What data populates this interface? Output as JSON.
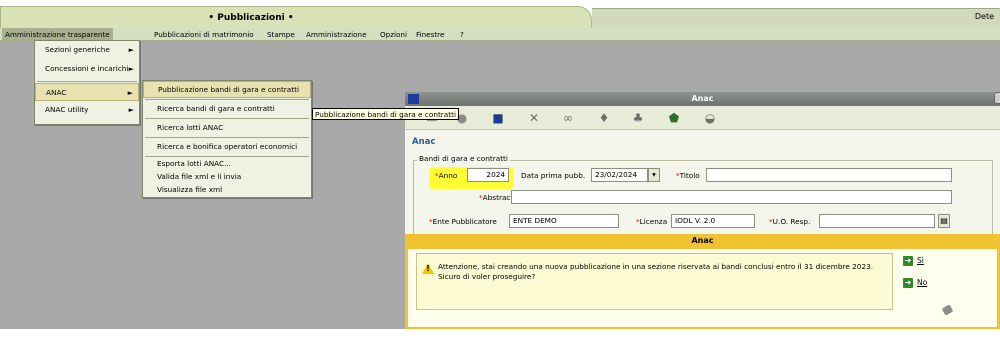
{
  "tabs": {
    "active_title": "• Pubblicazioni •",
    "other_title": "Dete"
  },
  "menubar": [
    "Amministrazione trasparente",
    "Pubblicazioni di matrimonio",
    "Stampe",
    "Amministrazione",
    "Opzioni",
    "Finestre",
    "?"
  ],
  "menu_level1": [
    "Sezioni generiche",
    "Concessioni e incarichi",
    "ANAC",
    "ANAC utility"
  ],
  "menu_level2": [
    "Pubblicazione bandi di gara e contratti",
    "Ricerca bandi di gara e contratti",
    "Ricerca lotti ANAC",
    "Ricerca e bonifica operatori economici",
    "Esporta lotti ANAC...",
    "Valida file xml e li invia",
    "Visualizza file xml"
  ],
  "tooltip": "Pubblicazione bandi di gara e contratti",
  "window": {
    "title": "Anac",
    "heading": "Anac",
    "group_legend": "Bandi di gara e contratti",
    "fields": {
      "anno_label": "Anno",
      "anno_value": "2024",
      "data_label": "Data prima pubb.",
      "data_value": "23/02/2024",
      "titolo_label": "Titolo",
      "titolo_value": "",
      "abstract_label": "Abstract",
      "abstract_value": "",
      "ente_label": "Ente Pubblicatore",
      "ente_value": "ENTE DEMO",
      "licenza_label": "Licenza",
      "licenza_value": "IODL V. 2.0",
      "uo_label": "U.O. Resp.",
      "uo_value": ""
    },
    "required_mark": "*"
  },
  "dialog": {
    "title": "Anac",
    "message_line1": "Attenzione, stai creando una nuova pubblicazione in una sezione riservata ai bandi conclusi entro il 31 dicembre 2023.",
    "message_line2": "Sicuro di voler proseguire?",
    "yes_label": "Sì",
    "no_label": "No"
  },
  "icons": {
    "toolbar": [
      "new-document-icon",
      "print-icon",
      "save-icon",
      "delete-icon",
      "search-binoculars-icon",
      "pin-icon",
      "people-icon",
      "shield-icon",
      "helmet-icon"
    ],
    "warning": "warning-icon",
    "yes": "green-arrow-icon",
    "no": "green-arrow-icon",
    "eraser": "eraser-icon"
  },
  "colors": {
    "highlight": "#ffff33",
    "dialog_frame": "#f1c232",
    "required": "#e00000",
    "heading": "#2e5a92"
  }
}
